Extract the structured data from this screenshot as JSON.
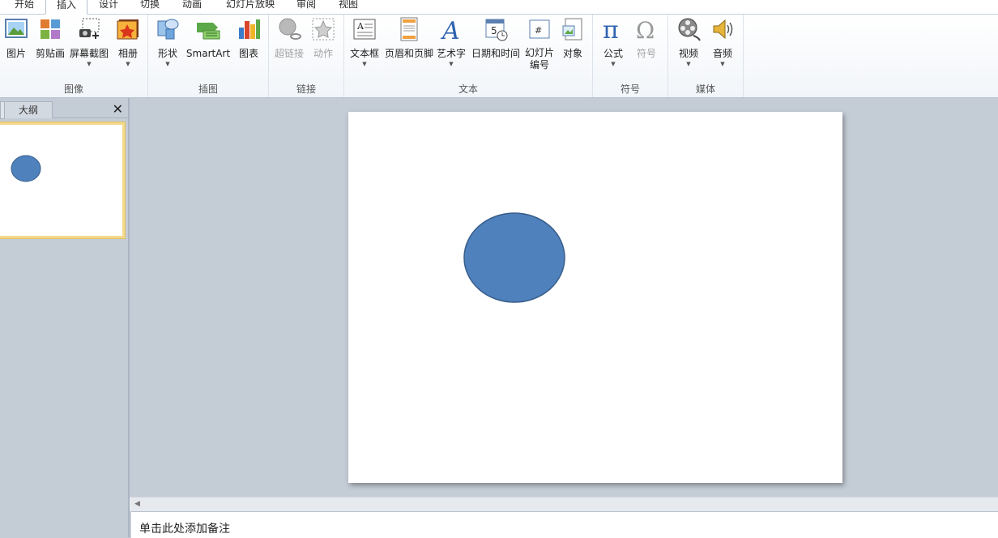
{
  "tabs": [
    "开始",
    "插入",
    "设计",
    "切换",
    "动画",
    "幻灯片放映",
    "审阅",
    "视图"
  ],
  "active_tab": "插入",
  "ribbon": {
    "groups": {
      "image": {
        "label": "图像",
        "buttons": {
          "picture": "图片",
          "clipart": "剪贴画",
          "screenshot": "屏幕截图",
          "album": "相册"
        }
      },
      "illustration": {
        "label": "插图",
        "buttons": {
          "shapes": "形状",
          "smartart": "SmartArt",
          "chart": "图表"
        }
      },
      "link": {
        "label": "链接",
        "buttons": {
          "hyperlink": "超链接",
          "action": "动作"
        }
      },
      "text": {
        "label": "文本",
        "buttons": {
          "textbox": "文本框",
          "headerfooter": "页眉和页脚",
          "wordart": "艺术字",
          "datetime": "日期和时间",
          "slidenumber_line1": "幻灯片",
          "slidenumber_line2": "编号",
          "object": "对象"
        }
      },
      "symbols": {
        "label": "符号",
        "buttons": {
          "equation": "公式",
          "symbol": "符号"
        }
      },
      "media": {
        "label": "媒体",
        "buttons": {
          "video": "视频",
          "audio": "音频"
        }
      }
    }
  },
  "left_panel": {
    "outline_tab": "大纲",
    "close": "✕"
  },
  "notes_placeholder": "单击此处添加备注",
  "colors": {
    "shape_fill": "#4f81bd",
    "shape_stroke": "#385d8a",
    "file_tab": "#c9341f",
    "selection": "#f2d98b"
  },
  "icons": {
    "picture": "picture-icon",
    "clipart": "clipart-icon",
    "screenshot": "screenshot-icon",
    "album": "album-icon",
    "shapes": "shapes-icon",
    "smartart": "smartart-icon",
    "chart": "chart-icon",
    "hyperlink": "globe-link-icon",
    "action": "star-action-icon",
    "textbox": "textbox-icon",
    "headerfooter": "header-footer-icon",
    "wordart": "wordart-icon",
    "datetime": "calendar-clock-icon",
    "slidenumber": "hash-icon",
    "object": "object-icon",
    "equation": "pi-icon",
    "symbol": "omega-icon",
    "video": "film-reel-icon",
    "audio": "speaker-icon"
  }
}
